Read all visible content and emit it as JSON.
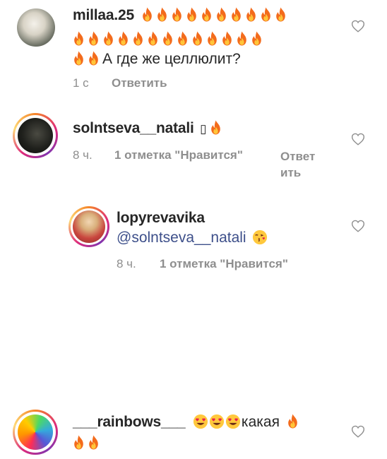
{
  "comments": [
    {
      "username": "millaa.25",
      "fire_line1_count": 10,
      "fire_line2_count": 13,
      "fire_line3_count": 2,
      "text": "А где же целлюлит?",
      "time": "1 с",
      "reply": "Ответить"
    },
    {
      "username": "solntseva__natali",
      "glyph": "▯",
      "time": "8 ч.",
      "likes": "1 отметка \"Нравится\"",
      "reply_line1": "Ответ",
      "reply_line2": "ить"
    },
    {
      "username": "lopyrevavika",
      "mention": "@solntseva__natali",
      "time": "8 ч.",
      "likes": "1 отметка \"Нравится\""
    },
    {
      "username": "___rainbows___",
      "text": "какая"
    }
  ],
  "icons": {
    "fire": "fire-emoji-icon",
    "kiss": "face-blowing-kiss-emoji-icon",
    "heart_eyes": "smiling-face-heart-eyes-emoji-icon",
    "like": "heart-outline-icon"
  },
  "colors": {
    "text": "#262626",
    "meta": "#8e8e8e",
    "mention": "#3d4f8a",
    "fire": "#f36b1c"
  }
}
